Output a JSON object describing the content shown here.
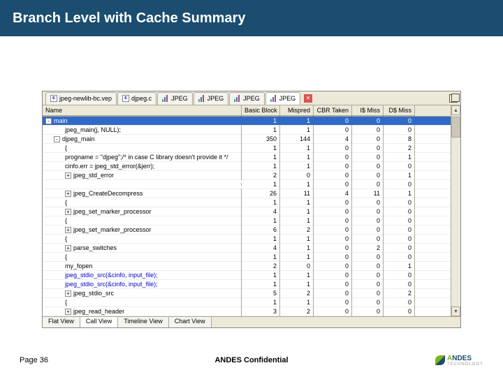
{
  "slide": {
    "title": "Branch Level with Cache Summary",
    "page": "Page 36",
    "confidential": "ANDES Confidential",
    "logo": "NDES",
    "logo_sub": "TECHNOLOGY"
  },
  "tabs": [
    {
      "label": "jpeg-newlib-bc.vep"
    },
    {
      "label": "djpeg.c"
    },
    {
      "label": "JPEG"
    },
    {
      "label": "JPEG"
    },
    {
      "label": "JPEG"
    },
    {
      "label": "JPEG"
    }
  ],
  "columns": {
    "name": "Name",
    "bb": "Basic Block",
    "mp": "Mispred",
    "cb": "CBR Taken",
    "im": "I$ Miss",
    "dm": "D$ Miss"
  },
  "rows": [
    {
      "name": "main",
      "ind": 0,
      "tog": "-",
      "bb": "1",
      "mp": "1",
      "cb": "0",
      "im": "0",
      "dm": "0",
      "sel": true
    },
    {
      "name": "jpeg_main(j, NULL);",
      "ind": 2,
      "bb": "1",
      "mp": "1",
      "cb": "0",
      "im": "0",
      "dm": "0"
    },
    {
      "name": "djpeg_main",
      "ind": 1,
      "tog": "-",
      "bb": "350",
      "mp": "144",
      "cb": "4",
      "im": "0",
      "dm": "8"
    },
    {
      "name": "{",
      "ind": 2,
      "bb": "1",
      "mp": "1",
      "cb": "0",
      "im": "0",
      "dm": "2"
    },
    {
      "name": "progname = \"djpeg\";/* in case C library doesn't provide it */",
      "ind": 2,
      "bb": "1",
      "mp": "1",
      "cb": "0",
      "im": "0",
      "dm": "1"
    },
    {
      "name": "cinfo.err = jpeg_std_error(&jerr);",
      "ind": 2,
      "bb": "1",
      "mp": "1",
      "cb": "0",
      "im": "0",
      "dm": "0"
    },
    {
      "name": "jpeg_std_error",
      "ind": 2,
      "tog": "+",
      "bb": "2",
      "mp": "0",
      "cb": "0",
      "im": "0",
      "dm": "1"
    },
    {
      "name": "",
      "ind": 2,
      "bb": "1",
      "mp": "1",
      "cb": "0",
      "im": "0",
      "dm": "0"
    },
    {
      "name": "jpeg_CreateDecompress",
      "ind": 2,
      "tog": "+",
      "bb": "26",
      "mp": "11",
      "cb": "4",
      "im": "11",
      "dm": "1"
    },
    {
      "name": "{",
      "ind": 2,
      "bb": "1",
      "mp": "1",
      "cb": "0",
      "im": "0",
      "dm": "0"
    },
    {
      "name": "jpeg_set_marker_processor",
      "ind": 2,
      "tog": "+",
      "bb": "4",
      "mp": "1",
      "cb": "0",
      "im": "0",
      "dm": "0"
    },
    {
      "name": "{",
      "ind": 2,
      "bb": "1",
      "mp": "1",
      "cb": "0",
      "im": "0",
      "dm": "0"
    },
    {
      "name": "jpeg_set_marker_processor",
      "ind": 2,
      "tog": "+",
      "bb": "6",
      "mp": "2",
      "cb": "0",
      "im": "0",
      "dm": "0"
    },
    {
      "name": "{",
      "ind": 2,
      "bb": "1",
      "mp": "1",
      "cb": "0",
      "im": "0",
      "dm": "0"
    },
    {
      "name": "parse_switches",
      "ind": 2,
      "tog": "+",
      "bb": "4",
      "mp": "1",
      "cb": "0",
      "im": "2",
      "dm": "0"
    },
    {
      "name": "{",
      "ind": 2,
      "bb": "1",
      "mp": "1",
      "cb": "0",
      "im": "0",
      "dm": "0"
    },
    {
      "name": "my_fopen",
      "ind": 2,
      "bb": "2",
      "mp": "0",
      "cb": "0",
      "im": "0",
      "dm": "1"
    },
    {
      "name": "jpeg_stdio_src(&cinfo, input_file);",
      "ind": 2,
      "blue": true,
      "bb": "1",
      "mp": "1",
      "cb": "0",
      "im": "0",
      "dm": "0"
    },
    {
      "name": "jpeg_stdio_src(&cinfo, input_file);",
      "ind": 2,
      "blue": true,
      "bb": "1",
      "mp": "1",
      "cb": "0",
      "im": "0",
      "dm": "0"
    },
    {
      "name": "jpeg_stdio_src",
      "ind": 2,
      "tog": "+",
      "bb": "5",
      "mp": "2",
      "cb": "0",
      "im": "0",
      "dm": "2"
    },
    {
      "name": "{",
      "ind": 2,
      "bb": "1",
      "mp": "1",
      "cb": "0",
      "im": "0",
      "dm": "0"
    },
    {
      "name": "jpeg_read_header",
      "ind": 2,
      "tog": "+",
      "bb": "3",
      "mp": "2",
      "cb": "0",
      "im": "0",
      "dm": "0"
    }
  ],
  "bottom_tabs": [
    "Flat View",
    "Call View",
    "Timeline View",
    "Chart View"
  ],
  "bottom_active": 1
}
